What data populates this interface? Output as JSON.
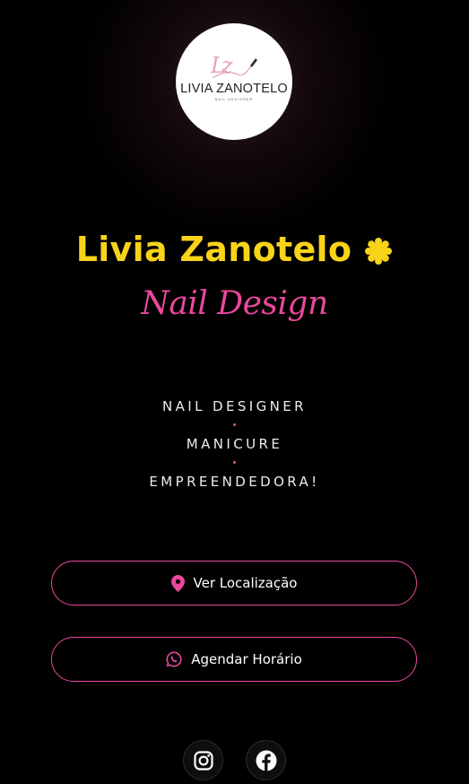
{
  "logo": {
    "monogram": "Lz",
    "name": "LIVIA ZANOTELO",
    "tagline": "NAIL DESIGNER"
  },
  "profile": {
    "name": "Livia Zanotelo",
    "verified_icon": "verified-badge-icon",
    "subtitle": "Nail Design"
  },
  "roles": [
    "NAIL DESIGNER",
    "MANICURE",
    "EMPREENDEDORA!"
  ],
  "buttons": {
    "location": {
      "label": "Ver Localização",
      "icon": "map-pin-icon"
    },
    "schedule": {
      "label": "Agendar Horário",
      "icon": "whatsapp-icon"
    }
  },
  "socials": [
    {
      "name": "instagram",
      "icon": "instagram-icon"
    },
    {
      "name": "facebook",
      "icon": "facebook-icon"
    }
  ],
  "colors": {
    "background": "#000000",
    "title": "#f7d319",
    "accent_pink": "#e9489c",
    "text": "#ffffff"
  }
}
